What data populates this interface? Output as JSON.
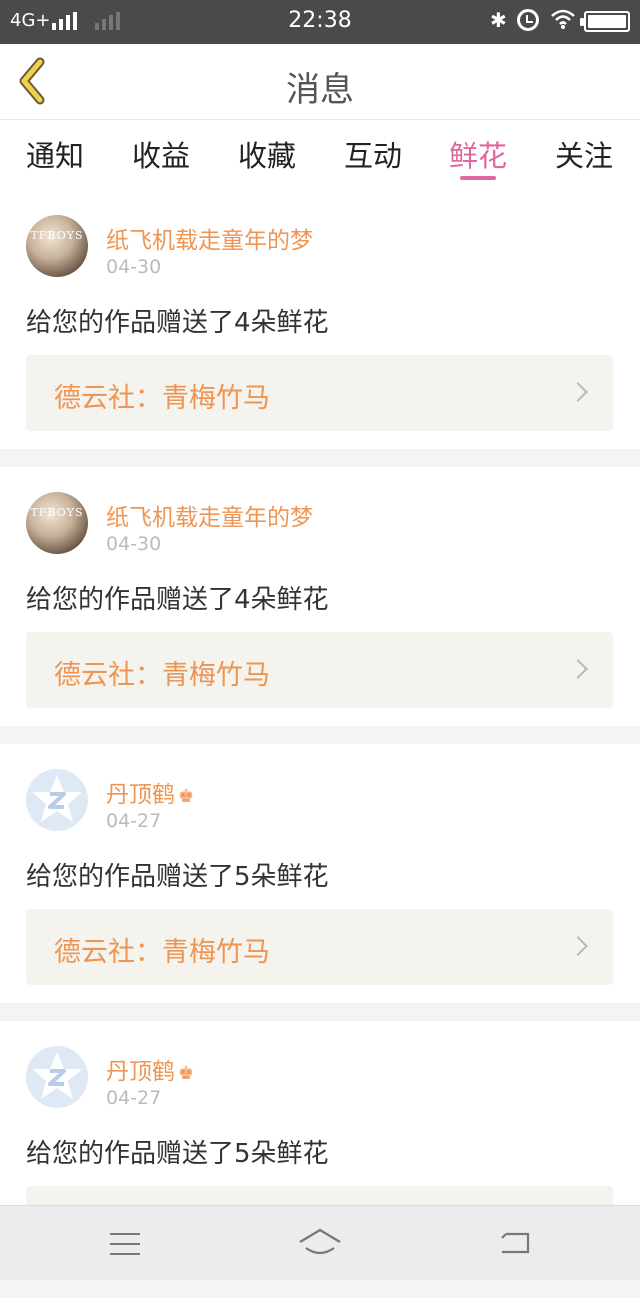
{
  "status_bar": {
    "network": "4G+",
    "time": "22:38",
    "bluetooth_icon": "bluetooth-icon",
    "alarm_icon": "alarm-icon",
    "wifi_icon": "wifi-icon",
    "battery_icon": "battery-icon"
  },
  "header": {
    "title": "消息",
    "back_icon": "chevron-left-icon"
  },
  "tabs": [
    {
      "label": "通知"
    },
    {
      "label": "收益"
    },
    {
      "label": "收藏"
    },
    {
      "label": "互动"
    },
    {
      "label": "鲜花",
      "active": true
    },
    {
      "label": "关注"
    }
  ],
  "colors": {
    "accent_pink": "#e0679f",
    "name_orange": "#ee9554",
    "card_bg": "#f4f3ee"
  },
  "messages": [
    {
      "user": "纸飞机载走童年的梦",
      "avatar_text": "TFBOYS",
      "date": "04-30",
      "text": "给您的作品赠送了4朵鲜花",
      "work": "德云社：青梅竹马"
    },
    {
      "user": "纸飞机载走童年的梦",
      "avatar_text": "TFBOYS",
      "date": "04-30",
      "text": "给您的作品赠送了4朵鲜花",
      "work": "德云社：青梅竹马"
    },
    {
      "user": "丹顶鹤",
      "crown_icon": "crown-icon",
      "avatar_icon": "default-avatar-star-icon",
      "date": "04-27",
      "text": "给您的作品赠送了5朵鲜花",
      "work": "德云社：青梅竹马"
    },
    {
      "user": "丹顶鹤",
      "crown_icon": "crown-icon",
      "avatar_icon": "default-avatar-star-icon",
      "date": "04-27",
      "text": "给您的作品赠送了5朵鲜花",
      "work": ""
    }
  ],
  "system_nav": {
    "menu_icon": "menu-icon",
    "home_icon": "home-icon",
    "back_icon": "back-icon"
  }
}
